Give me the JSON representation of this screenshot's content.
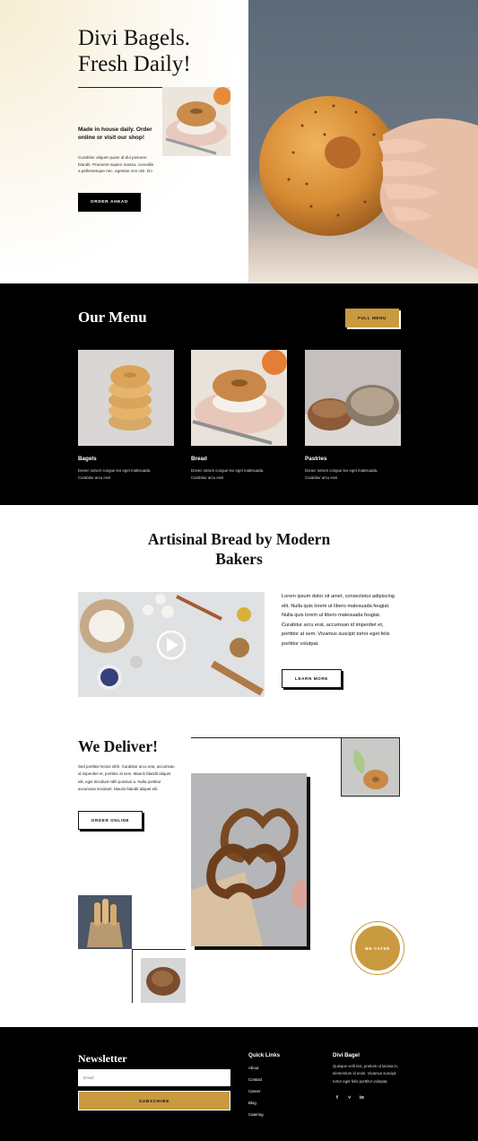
{
  "hero": {
    "title_line1": "Divi Bagels.",
    "title_line2": "Fresh Daily!",
    "subtitle": "Made in house daily. Order online or visit our shop!",
    "body": "Curabitur aliquet quam id dui posuere blandit. Praesent sapien massa, convallis a pellentesque nec, egestas non nisi. Do",
    "button": "ORDER AHEAD"
  },
  "menu": {
    "title": "Our Menu",
    "button": "FULL MENU",
    "items": [
      {
        "name": "Bagels",
        "desc": "Donec rutrum congue leo eget malesuada. Curabitur arcu erat"
      },
      {
        "name": "Bread",
        "desc": "Donec rutrum congue leo eget malesuada. Curabitur arcu erat"
      },
      {
        "name": "Pastries",
        "desc": "Donec rutrum congue leo eget malesuada. Curabitur arcu erat"
      }
    ]
  },
  "artisinal": {
    "title": "Artisinal Bread by Modern Bakers",
    "text": "Lorem ipsum dolor sit amet, consectetur adipiscing elit. Nulla quis lorem ut libero malesuada feugiat. Nulla quis lorem ut libero malesuada feugiat. Curabitur arcu erat, accumsan id imperdiet et, porttitor at sem. Vivamus suscipit tortor eget felis porttitor volutpat.",
    "button": "LEARN MORE"
  },
  "deliver": {
    "title": "We Deliver!",
    "text": "Sed porttitor lectus nibh. Curabitur arcu erat, accumsan id imperdiet et, porttitor at sem. Mauris blandit aliquet elit, eget tincidunt nibh pulvinar a. Nulla porttitor accumsan tincidunt. Mauris blandit aliquet elit.",
    "button": "ORDER ONLINE",
    "cater": "WE CATER"
  },
  "footer": {
    "newsletter_title": "Newsletter",
    "email_placeholder": "Email",
    "subscribe": "SUBSCRIBE",
    "quick_links_title": "Quick Links",
    "quick_links": [
      "About",
      "Contact",
      "Career",
      "Blog",
      "Catering"
    ],
    "brand_title": "Divi Bagel",
    "brand_text": "Quisque velit nisi, pretium ut lacinia in, elementum id enim. Vivamus suscipit tortor eget felis porttitor volutpat.",
    "social": [
      {
        "icon": "facebook-icon",
        "glyph": "f"
      },
      {
        "icon": "twitter-icon",
        "glyph": "˅"
      },
      {
        "icon": "linkedin-icon",
        "glyph": "in"
      }
    ]
  },
  "colors": {
    "accent_gold": "#c99a3f",
    "black": "#000000"
  }
}
